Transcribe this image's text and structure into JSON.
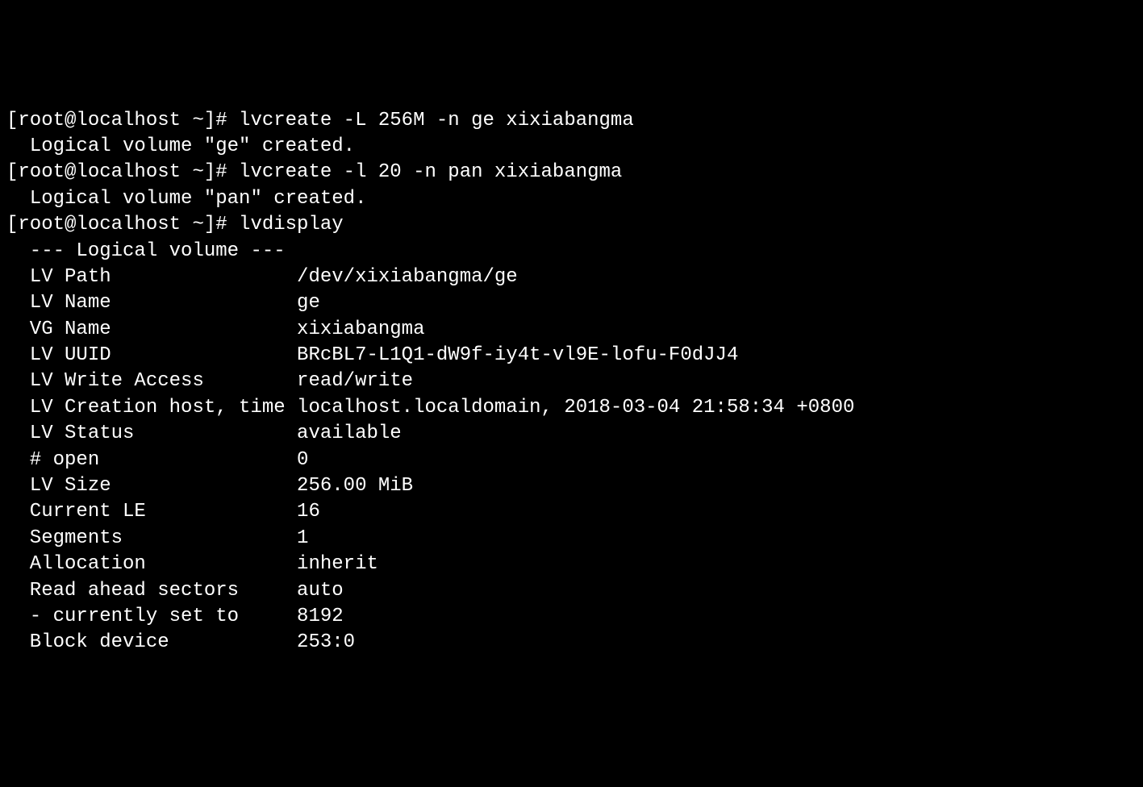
{
  "terminal": {
    "lines": [
      "[root@localhost ~]# lvcreate -L 256M -n ge xixiabangma",
      "  Logical volume \"ge\" created.",
      "[root@localhost ~]# lvcreate -l 20 -n pan xixiabangma",
      "  Logical volume \"pan\" created.",
      "[root@localhost ~]# lvdisplay",
      "  --- Logical volume ---",
      "  LV Path                /dev/xixiabangma/ge",
      "  LV Name                ge",
      "  VG Name                xixiabangma",
      "  LV UUID                BRcBL7-L1Q1-dW9f-iy4t-vl9E-lofu-F0dJJ4",
      "  LV Write Access        read/write",
      "  LV Creation host, time localhost.localdomain, 2018-03-04 21:58:34 +0800",
      "  LV Status              available",
      "  # open                 0",
      "  LV Size                256.00 MiB",
      "  Current LE             16",
      "  Segments               1",
      "  Allocation             inherit",
      "  Read ahead sectors     auto",
      "  - currently set to     8192",
      "  Block device           253:0"
    ]
  }
}
